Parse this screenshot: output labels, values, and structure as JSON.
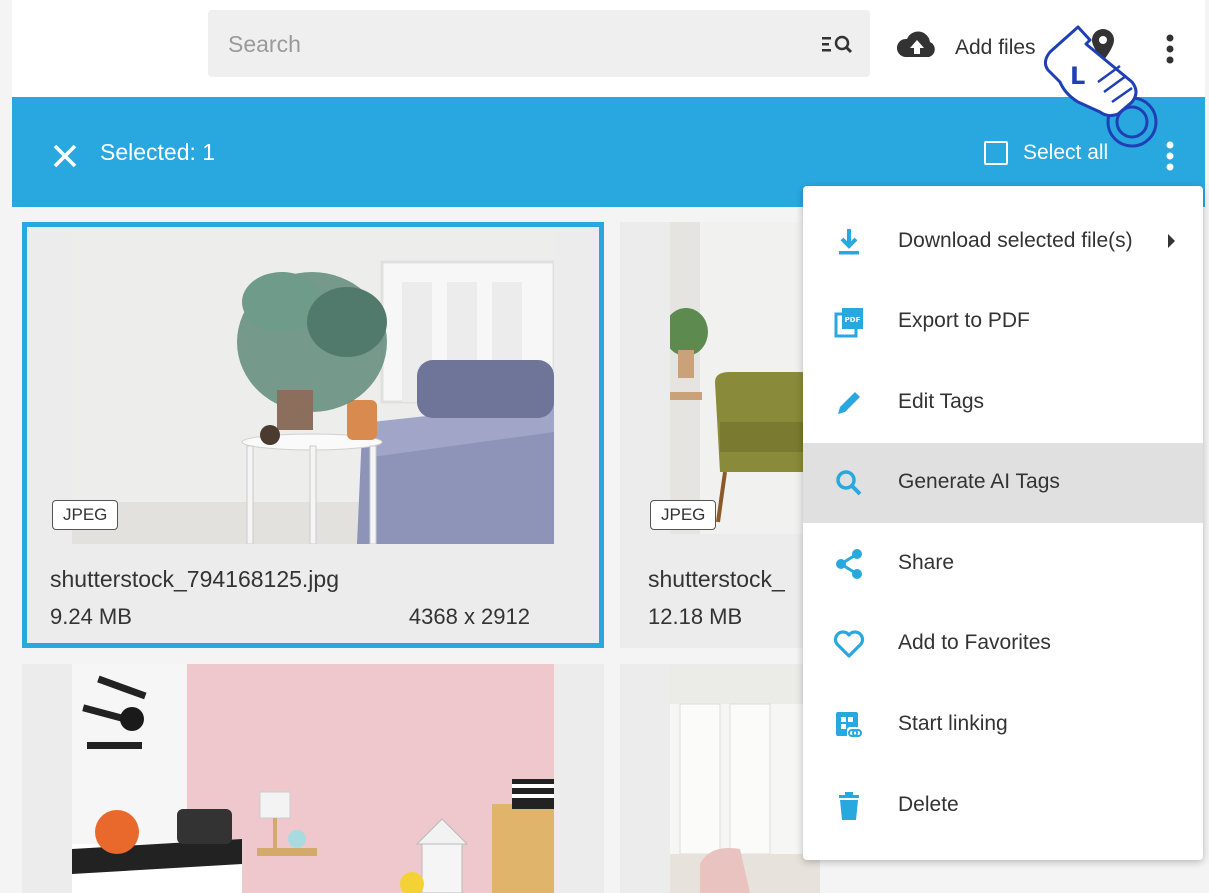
{
  "header": {
    "search_placeholder": "Search",
    "add_files_label": "Add files"
  },
  "selection_bar": {
    "selected_text": "Selected: 1",
    "select_all_label": "Select all"
  },
  "files": [
    {
      "type": "JPEG",
      "name": "shutterstock_794168125.jpg",
      "size": "9.24 MB",
      "dimensions": "4368 x 2912",
      "selected": true
    },
    {
      "type": "JPEG",
      "name": "shutterstock_",
      "size": "12.18 MB",
      "dimensions": "",
      "selected": false
    }
  ],
  "context_menu": {
    "items": [
      {
        "label": "Download selected file(s)",
        "icon": "download-icon"
      },
      {
        "label": "Export to PDF",
        "icon": "pdf-icon"
      },
      {
        "label": "Edit Tags",
        "icon": "pencil-icon"
      },
      {
        "label": "Generate AI Tags",
        "icon": "search-icon",
        "highlighted": true
      },
      {
        "label": "Share",
        "icon": "share-icon"
      },
      {
        "label": "Add to Favorites",
        "icon": "heart-icon"
      },
      {
        "label": "Start linking",
        "icon": "link-icon"
      },
      {
        "label": "Delete",
        "icon": "trash-icon"
      }
    ]
  },
  "cursor": {
    "letter": "L"
  },
  "colors": {
    "accent": "#29a8e0",
    "highlight": "#e0e0e0",
    "pointer": "#1f3fb5"
  }
}
